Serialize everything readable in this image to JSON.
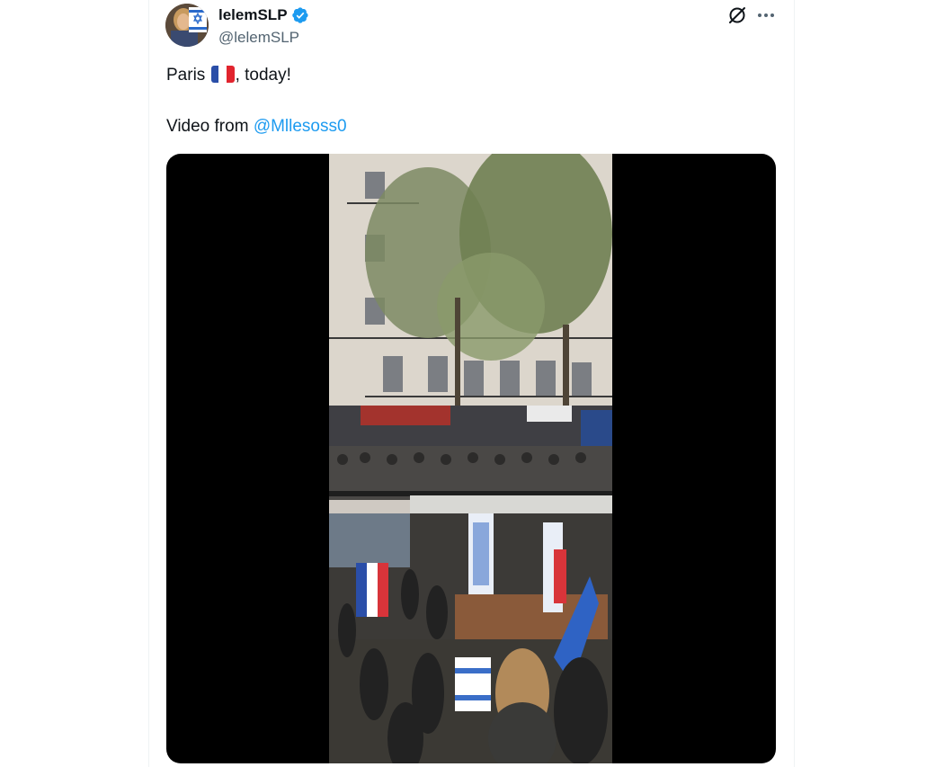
{
  "author": {
    "display_name": "lelemSLP",
    "handle": "@lelemSLP",
    "verified": true,
    "avatar": "avatar-with-star-of-david"
  },
  "actions": {
    "grok_icon": "grok-slash-circle-icon",
    "more_icon": "more-horizontal-icon"
  },
  "tweet": {
    "line1_prefix": "Paris ",
    "line1_flag": "flag-france-icon",
    "line1_suffix": ", today!",
    "line2_prefix": "Video from ",
    "line2_mention": "@Mllesoss0"
  },
  "media": {
    "type": "video",
    "scene": "street-demonstration-with-flags"
  },
  "colors": {
    "link": "#1d9bf0",
    "verified": "#1d9bf0",
    "secondary_text": "#536471",
    "primary_text": "#0f1419"
  }
}
